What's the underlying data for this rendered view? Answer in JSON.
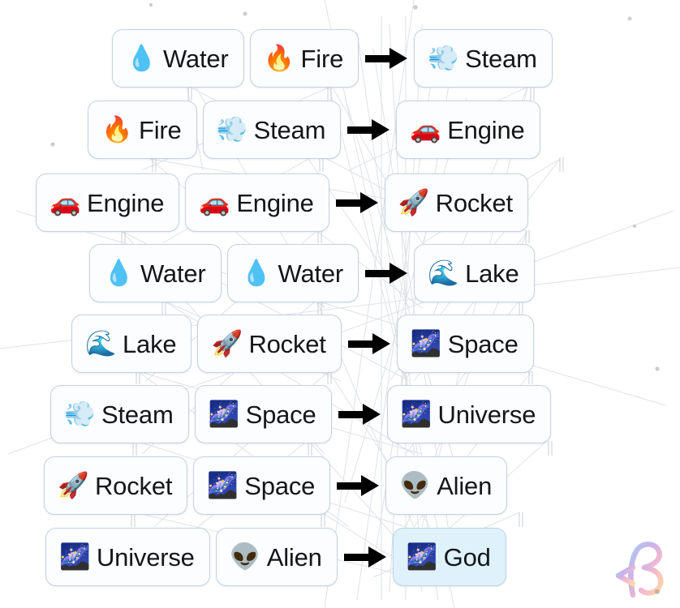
{
  "app": {
    "name": "Infinite Craft",
    "view": "crafting-recipe-tree",
    "background_color": "#ffffff",
    "card_background": "#fbfdfe",
    "card_border": "#c3d2e2",
    "highlight_background": "#dff1fb",
    "text_color": "#13161a",
    "arrow_color": "#000000"
  },
  "arrow": {
    "glyph": "→",
    "name": "yields-arrow"
  },
  "recipes": [
    {
      "row": 1,
      "left": {
        "emoji": "💧",
        "icon": "water-drop-icon",
        "label": "Water"
      },
      "right": {
        "emoji": "🔥",
        "icon": "fire-icon",
        "label": "Fire"
      },
      "result": {
        "emoji": "💨",
        "icon": "steam-puff-icon",
        "label": "Steam",
        "highlighted": false
      }
    },
    {
      "row": 2,
      "left": {
        "emoji": "🔥",
        "icon": "fire-icon",
        "label": "Fire"
      },
      "right": {
        "emoji": "💨",
        "icon": "steam-puff-icon",
        "label": "Steam"
      },
      "result": {
        "emoji": "🚗",
        "icon": "car-engine-icon",
        "label": "Engine",
        "highlighted": false
      }
    },
    {
      "row": 3,
      "left": {
        "emoji": "🚗",
        "icon": "car-engine-icon",
        "label": "Engine"
      },
      "right": {
        "emoji": "🚗",
        "icon": "car-engine-icon",
        "label": "Engine"
      },
      "result": {
        "emoji": "🚀",
        "icon": "rocket-icon",
        "label": "Rocket",
        "highlighted": false
      }
    },
    {
      "row": 4,
      "left": {
        "emoji": "💧",
        "icon": "water-drop-icon",
        "label": "Water"
      },
      "right": {
        "emoji": "💧",
        "icon": "water-drop-icon",
        "label": "Water"
      },
      "result": {
        "emoji": "🌊",
        "icon": "wave-lake-icon",
        "label": "Lake",
        "highlighted": false
      }
    },
    {
      "row": 5,
      "left": {
        "emoji": "🌊",
        "icon": "wave-lake-icon",
        "label": "Lake"
      },
      "right": {
        "emoji": "🚀",
        "icon": "rocket-icon",
        "label": "Rocket"
      },
      "result": {
        "emoji": "🌌",
        "icon": "galaxy-space-icon",
        "label": "Space",
        "highlighted": false
      }
    },
    {
      "row": 6,
      "left": {
        "emoji": "💨",
        "icon": "steam-puff-icon",
        "label": "Steam"
      },
      "right": {
        "emoji": "🌌",
        "icon": "galaxy-space-icon",
        "label": "Space"
      },
      "result": {
        "emoji": "🌌",
        "icon": "galaxy-space-icon",
        "label": "Universe",
        "highlighted": false
      }
    },
    {
      "row": 7,
      "left": {
        "emoji": "🚀",
        "icon": "rocket-icon",
        "label": "Rocket"
      },
      "right": {
        "emoji": "🌌",
        "icon": "galaxy-space-icon",
        "label": "Space"
      },
      "result": {
        "emoji": "👽",
        "icon": "alien-head-icon",
        "label": "Alien",
        "highlighted": false
      }
    },
    {
      "row": 8,
      "left": {
        "emoji": "🌌",
        "icon": "galaxy-space-icon",
        "label": "Universe"
      },
      "right": {
        "emoji": "👽",
        "icon": "alien-head-icon",
        "label": "Alien"
      },
      "result": {
        "emoji": "🌌",
        "icon": "galaxy-space-icon",
        "label": "God",
        "highlighted": true
      }
    }
  ],
  "watermark": {
    "name": "pastel-b-logo",
    "colors": [
      "#a9c8f5",
      "#c9aee8",
      "#f6b8c8",
      "#fbd9a2"
    ]
  }
}
